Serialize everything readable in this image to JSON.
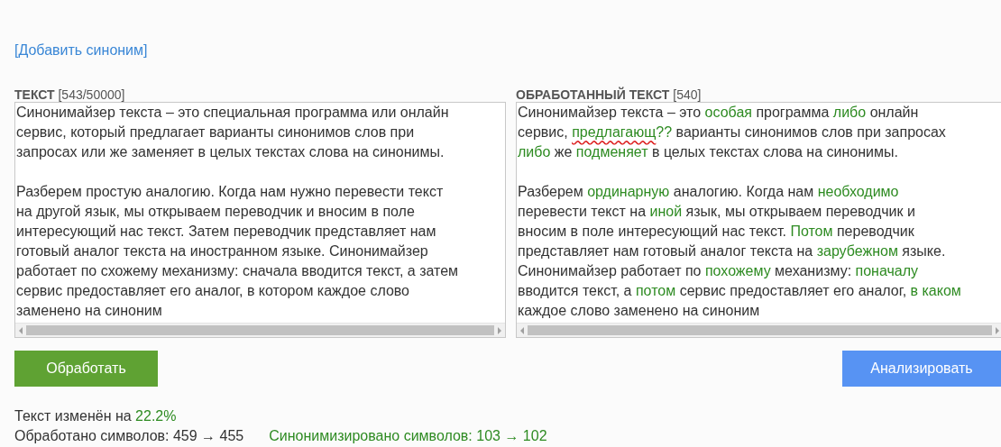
{
  "add_synonym_link": "[Добавить синоним]",
  "source": {
    "label": "ТЕКСТ",
    "count_open": "[",
    "count": "543",
    "count_sep": "/",
    "limit": "50000",
    "count_close": "]",
    "paragraphs": [
      [
        "Синонимайзер текста – это специальная программа или онлайн",
        "сервис, который предлагает варианты синонимов слов при",
        "запросах или же заменяет в целых текстах слова на синонимы."
      ],
      [
        "Разберем простую аналогию. Когда нам нужно перевести текст",
        "на другой язык, мы открываем переводчик и вносим в поле",
        "интересующий нас текст. Затем переводчик представляет нам",
        "готовый аналог текста на иностранном языке. Синонимайзер",
        "работает по схожему механизму: сначала вводится текст, а затем",
        "сервис предоставляет его аналог, в котором каждое слово",
        "заменено на синоним"
      ]
    ]
  },
  "result": {
    "label": "ОБРАБОТАННЫЙ ТЕКСТ",
    "count": "[540]",
    "paragraphs": [
      [
        [
          {
            "text": "Синонимайзер текста – это ",
            "kind": "plain"
          },
          {
            "text": "особая",
            "kind": "synonym"
          },
          {
            "text": " программа ",
            "kind": "plain"
          },
          {
            "text": "либо",
            "kind": "synonym"
          },
          {
            "text": " онлайн",
            "kind": "plain"
          }
        ],
        [
          {
            "text": "сервис, ",
            "kind": "plain"
          },
          {
            "text": "предлагающ",
            "kind": "misspelled"
          },
          {
            "text": "??",
            "kind": "synonym"
          },
          {
            "text": " варианты синонимов слов при запросах",
            "kind": "plain"
          }
        ],
        [
          {
            "text": "либо",
            "kind": "synonym"
          },
          {
            "text": " же ",
            "kind": "plain"
          },
          {
            "text": "подменяет",
            "kind": "synonym"
          },
          {
            "text": " в целых текстах слова на синонимы.",
            "kind": "plain"
          }
        ]
      ],
      [
        [
          {
            "text": "Разберем ",
            "kind": "plain"
          },
          {
            "text": "ординарную",
            "kind": "synonym"
          },
          {
            "text": " аналогию. Когда нам ",
            "kind": "plain"
          },
          {
            "text": "необходимо",
            "kind": "synonym"
          }
        ],
        [
          {
            "text": "перевести текст на ",
            "kind": "plain"
          },
          {
            "text": "иной",
            "kind": "synonym"
          },
          {
            "text": " язык, мы открываем переводчик и",
            "kind": "plain"
          }
        ],
        [
          {
            "text": "вносим в поле интересующий нас текст. ",
            "kind": "plain"
          },
          {
            "text": "Потом",
            "kind": "synonym"
          },
          {
            "text": " переводчик",
            "kind": "plain"
          }
        ],
        [
          {
            "text": "представляет нам готовый аналог текста на ",
            "kind": "plain"
          },
          {
            "text": "зарубежном",
            "kind": "synonym"
          },
          {
            "text": " языке.",
            "kind": "plain"
          }
        ],
        [
          {
            "text": "Синонимайзер работает по ",
            "kind": "plain"
          },
          {
            "text": "похожему",
            "kind": "synonym"
          },
          {
            "text": " механизму: ",
            "kind": "plain"
          },
          {
            "text": "поначалу",
            "kind": "synonym"
          }
        ],
        [
          {
            "text": "вводится текст, а ",
            "kind": "plain"
          },
          {
            "text": "потом",
            "kind": "synonym"
          },
          {
            "text": " сервис предоставляет его аналог, ",
            "kind": "plain"
          },
          {
            "text": "в каком",
            "kind": "synonym"
          }
        ],
        [
          {
            "text": "каждое слово заменено на синоним",
            "kind": "plain"
          }
        ]
      ]
    ]
  },
  "buttons": {
    "process": "Обработать",
    "analyze": "Анализировать"
  },
  "stats": {
    "changed_label": "Текст изменён на",
    "changed_value": "22.2%",
    "processed": "Обработано символов: 459 → 455",
    "synonymized": "Синонимизировано символов: 103 → 102"
  }
}
